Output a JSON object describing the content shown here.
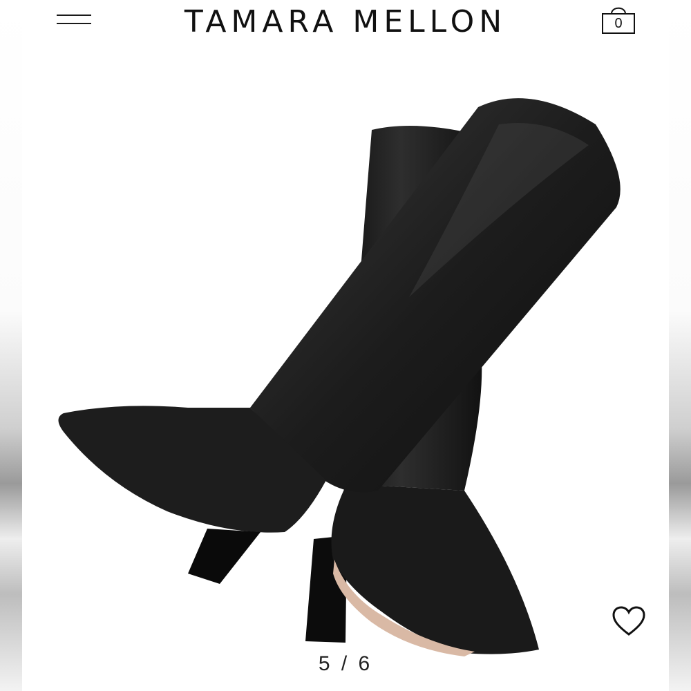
{
  "header": {
    "brand": "TAMARA MELLON",
    "menu_icon": "hamburger-menu-icon",
    "cart_icon": "shopping-bag-icon",
    "cart_count": "0"
  },
  "gallery": {
    "product_image_subject": "knee-high black leather boots with block heels",
    "pagination": "5 / 6",
    "current_index": 5,
    "total": 6,
    "wishlist_icon": "heart-outline-icon"
  },
  "colors": {
    "background": "#ffffff",
    "text": "#111111",
    "boot_leather": "#1b1b1b"
  }
}
